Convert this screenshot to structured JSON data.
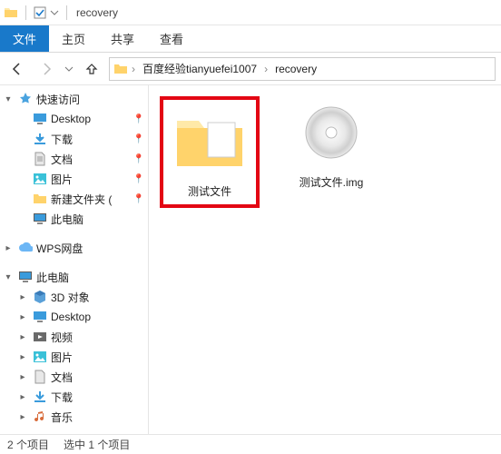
{
  "window": {
    "title": "recovery"
  },
  "ribbon": {
    "file_tab": "文件",
    "tabs": [
      "主页",
      "共享",
      "查看"
    ]
  },
  "breadcrumb": {
    "segments": [
      "百度经验tianyuefei1007",
      "recovery"
    ]
  },
  "sidebar": {
    "groups": [
      {
        "label": "快速访问",
        "expander": "▾",
        "icon": "quick-access",
        "children": [
          {
            "label": "Desktop",
            "icon": "desktop",
            "pinned": true
          },
          {
            "label": "下载",
            "icon": "downloads",
            "pinned": true
          },
          {
            "label": "文档",
            "icon": "documents",
            "pinned": true
          },
          {
            "label": "图片",
            "icon": "pictures",
            "pinned": true
          },
          {
            "label": "新建文件夹 (",
            "icon": "folder",
            "pinned": true
          },
          {
            "label": "此电脑",
            "icon": "this-pc",
            "pinned": false
          }
        ]
      },
      {
        "label": "WPS网盘",
        "expander": "▸",
        "icon": "cloud",
        "children": []
      },
      {
        "label": "此电脑",
        "expander": "▾",
        "icon": "this-pc",
        "children": [
          {
            "label": "3D 对象",
            "icon": "objects3d"
          },
          {
            "label": "Desktop",
            "icon": "desktop"
          },
          {
            "label": "视频",
            "icon": "videos"
          },
          {
            "label": "图片",
            "icon": "pictures"
          },
          {
            "label": "文档",
            "icon": "documents"
          },
          {
            "label": "下载",
            "icon": "downloads"
          },
          {
            "label": "音乐",
            "icon": "music"
          }
        ]
      }
    ]
  },
  "files": {
    "items": [
      {
        "name": "测试文件",
        "type": "folder",
        "highlighted": true
      },
      {
        "name": "测试文件.img",
        "type": "disc",
        "highlighted": false
      }
    ]
  },
  "status": {
    "item_count": "2 个项目",
    "selection": "选中 1 个项目"
  },
  "icons": {
    "pin": "📌",
    "chevron": "›"
  }
}
